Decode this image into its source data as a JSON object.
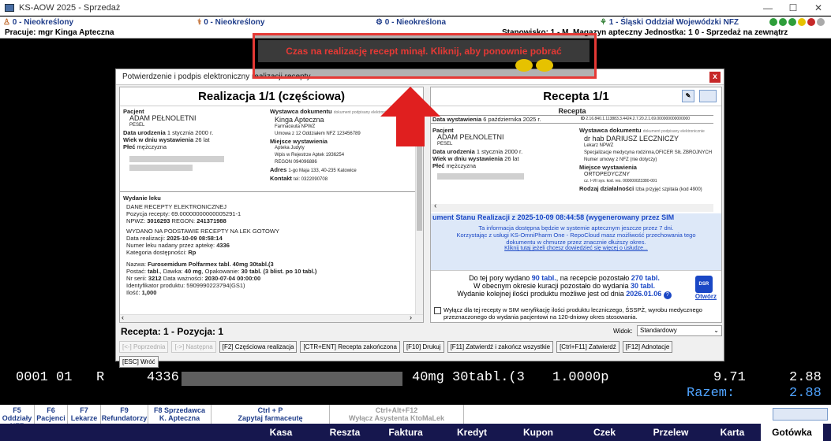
{
  "window": {
    "title": "KS-AOW 2025 - Sprzedaż"
  },
  "infobar": {
    "i1": "0 - Nieokreślony",
    "i2": "0 - Nieokreślony",
    "i3": "0 - Nieokreślona",
    "i4": "1 - Śląski Oddział Wojewódzki NFZ"
  },
  "workbar": {
    "left": "Pracuje: mgr Kinga Apteczna",
    "right": "Stanowisko: 1 - M. Magazyn apteczny  Jednostka: 1  0 - Sprzedaż na zewnątrz"
  },
  "alert": {
    "text": "Czas na realizację recept minął. Kliknij, aby ponownie pobrać"
  },
  "modal": {
    "title": "Potwierdzenie i podpis elektroniczny realizacji recepty",
    "left": {
      "heading": "Realizacja 1/1 (częściowa)",
      "patient_h": "Pacjent",
      "patient_name": "ADAM PEŁNOLETNI",
      "pesel": "PESEL",
      "dob_l": "Data urodzenia",
      "dob": "1 stycznia 2000 r.",
      "age_l": "Wiek w dniu wystawienia",
      "age": "26 lat",
      "sex_l": "Płeć",
      "sex": "mężczyzna",
      "issuer_h": "Wystawca dokumentu",
      "issuer_note": "dokument podpisany elektronicznie",
      "issuer_name": "Kinga Apteczna",
      "issuer_role": "Farmaceuta NPWZ",
      "contract": "Umowa z 12 Oddziałem NFZ 123456789",
      "place_h": "Miejsce wystawienia",
      "place1": "Apteka Judyty",
      "place2": "Wpis w Rejestrze Aptek 1936254",
      "place3": "REGON 094096886",
      "addr_l": "Adres",
      "addr": "1-go Maja 133, 40-235 Katowice",
      "contact_l": "Kontakt",
      "contact": "tel: 0322090708",
      "issue_h": "Wydanie leku",
      "l1": "DANE RECEPTY ELEKTRONICZNEJ",
      "l2": "Pozycja recepty: 69.00000000000005291-1",
      "l3a": "NPWZ: ",
      "l3b": "3016293",
      "l3c": " REGON: ",
      "l3d": "241371988",
      "l4": "WYDANO NA PODSTAWIE RECEPTY NA LEK GOTOWY",
      "l5a": "Data realizacji: ",
      "l5b": "2025-10-09 08:58:14",
      "l6a": "Numer leku nadany przez aptekę: ",
      "l6b": "4336",
      "l7a": "Kategoria dostępności: ",
      "l7b": "Rp",
      "l8a": "Nazwa: ",
      "l8b": "Furosemidum Polfarmex tabl. 40mg 30tabl.(3",
      "l9a": "Postać: ",
      "l9b": "tabl.",
      "l9c": ", Dawka: ",
      "l9d": "40 mg",
      "l9e": ", Opakowanie: ",
      "l9f": "30 tabl. (3 blist. po 10 tabl.)",
      "l10a": "Nr serii: ",
      "l10b": "3212",
      "l10c": " Data ważności: ",
      "l10d": "2030-07-04 00:00:00",
      "l11a": "Identyfikator produktu: ",
      "l11b": "5909990223794(GS1)",
      "l12a": "Ilość: ",
      "l12b": "1,000"
    },
    "right": {
      "heading": "Recepta 1/1",
      "sub": "Recepta",
      "date_l": "Data wystawienia",
      "date": "6 października 2025 r.",
      "id_l": "ID",
      "id": "2.16.840.1.113883.3.4424.2.7.20.2.1.69.000000000000000",
      "patient_h": "Pacjent",
      "patient_name": "ADAM PEŁNOLETNI",
      "pesel": "PESEL",
      "dob_l": "Data urodzenia",
      "dob": "1 stycznia 2000 r.",
      "age_l": "Wiek w dniu wystawienia",
      "age": "26 lat",
      "sex_l": "Płeć",
      "sex": "mężczyzna",
      "issuer_h": "Wystawca dokumentu",
      "issuer_note": "dokument podpisany elektronicznie",
      "issuer_name": "dr hab DARIUSZ LECZNICZY",
      "issuer_role": "Lekarz NPWZ",
      "spec": "Specjalizacje medycyna rodzinna,OFICER SIŁ ZBROJNYCH",
      "contract": "Numer umowy z NFZ (nie dotyczy)",
      "place_h": "Miejsce wystawienia",
      "place1": "ORTOPEDYCZNY",
      "place2": "cz. I-VII sys. kod. res. 000000023380-001",
      "kind_l": "Rodzaj działalności",
      "kind": "Izba przyjęć szpitala (kod 4900)",
      "status_line": "ument Stanu Realizacji z 2025-10-09 08:44:58 (wygenerowany przez SIM",
      "info1": "Ta informacja dostępna będzie w systemie aptecznym jeszcze przez 7 dni.",
      "info2": "Korzystając z usługi KS-OmniPharm One - RepoCloud masz możliwość przechowania tego",
      "info3": "dokumentu w chmurze przez znacznie dłuższy okres.",
      "info4": "Kliknij tutaj jeżeli chcesz dowiedzieć się więcej o usłudze...",
      "q1a": "Do tej pory wydano ",
      "q1b": "90 tabl.",
      "q1c": ", na recepcie pozostało ",
      "q1d": "270 tabl.",
      "q2a": "W obecnym okresie kuracji pozostało do wydania ",
      "q2b": "30 tabl.",
      "q3a": "Wydanie kolejnej ilości produktu możliwe jest od dnia ",
      "q3b": "2026.01.06",
      "dsr": "DSR",
      "open": "Otwórz",
      "chk": "Wyłącz dla tej recepty w SIM weryfikację ilości produktu leczniczego, ŚSSPŻ, wyrobu medycznego przeznaczonego do wydania pacjentowi na 120-dniowy okres stosowania."
    },
    "footer": {
      "pos": "Recepta: 1 - Pozycja: 1",
      "view_l": "Widok:",
      "view": "Standardowy",
      "b1": "[<-] Poprzednia",
      "b2": "[->] Następna",
      "b3": "[F2] Częściowa realizacja",
      "b4": "[CTR+ENT] Recepta zakończona",
      "b5": "[F10] Drukuj",
      "b6": "[F11] Zatwierdź i zakończ wszystkie",
      "b7": "[Ctrl+F11] Zatwierdź",
      "b8": "[F12] Adnotacje",
      "b9": "[ESC] Wróć"
    }
  },
  "sales": {
    "c1": "0001 01",
    "c2": "R",
    "c3": "4336",
    "c4": "40mg 30tabl.(3",
    "c5": "1.0000p",
    "c6": "9.71",
    "c7": "2.88",
    "total_l": "Razem:",
    "total": "2.88"
  },
  "fkeys": [
    {
      "k": "F5",
      "l": "Oddziały NFZ"
    },
    {
      "k": "F6",
      "l": "Pacjenci"
    },
    {
      "k": "F7",
      "l": "Lekarze"
    },
    {
      "k": "F9",
      "l": "Refundatorzy"
    },
    {
      "k": "F8 Sprzedawca",
      "l": "K. Apteczna"
    },
    {
      "k": "Ctrl + P",
      "l": "Zapytaj farmaceutę"
    },
    {
      "k": "Ctrl+Alt+F12",
      "l": "Wyłącz Asystenta KtoMaLek"
    }
  ],
  "pay": [
    "Kasa",
    "Reszta",
    "Faktura",
    "Kredyt",
    "Kupon",
    "Czek",
    "Przelew",
    "Karta",
    "Gotówka"
  ]
}
